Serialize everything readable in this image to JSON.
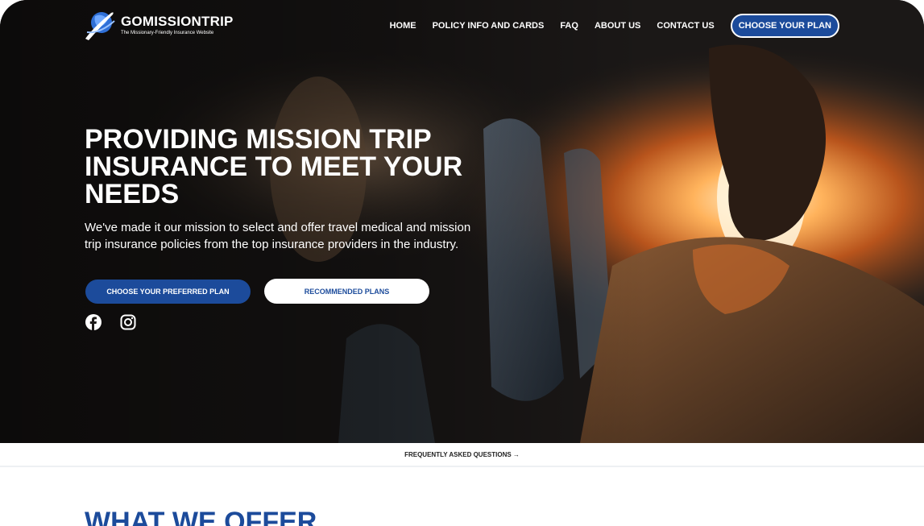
{
  "brand": {
    "name": "GOMISSIONTRIP",
    "tagline": "The Missionary-Friendly Insurance Website"
  },
  "nav": {
    "items": [
      "HOME",
      "POLICY INFO AND CARDS",
      "FAQ",
      "ABOUT US",
      "CONTACT US"
    ],
    "cta": "CHOOSE YOUR PLAN"
  },
  "hero": {
    "headline": "PROVIDING MISSION TRIP INSURANCE TO MEET YOUR NEEDS",
    "description": "We've made it our mission to select and offer travel medical and mission trip insurance policies from the top insurance providers in the industry.",
    "primary_button": "CHOOSE YOUR PREFERRED PLAN",
    "secondary_button": "RECOMMENDED PLANS",
    "social_icons": [
      "facebook-icon",
      "instagram-icon"
    ]
  },
  "faq_bar": {
    "link": "FREQUENTLY ASKED QUESTIONS →"
  },
  "section": {
    "title": "WHAT WE OFFER"
  },
  "colors": {
    "brand_blue": "#1c4b9b",
    "white": "#ffffff",
    "divider": "#eef0f3"
  }
}
